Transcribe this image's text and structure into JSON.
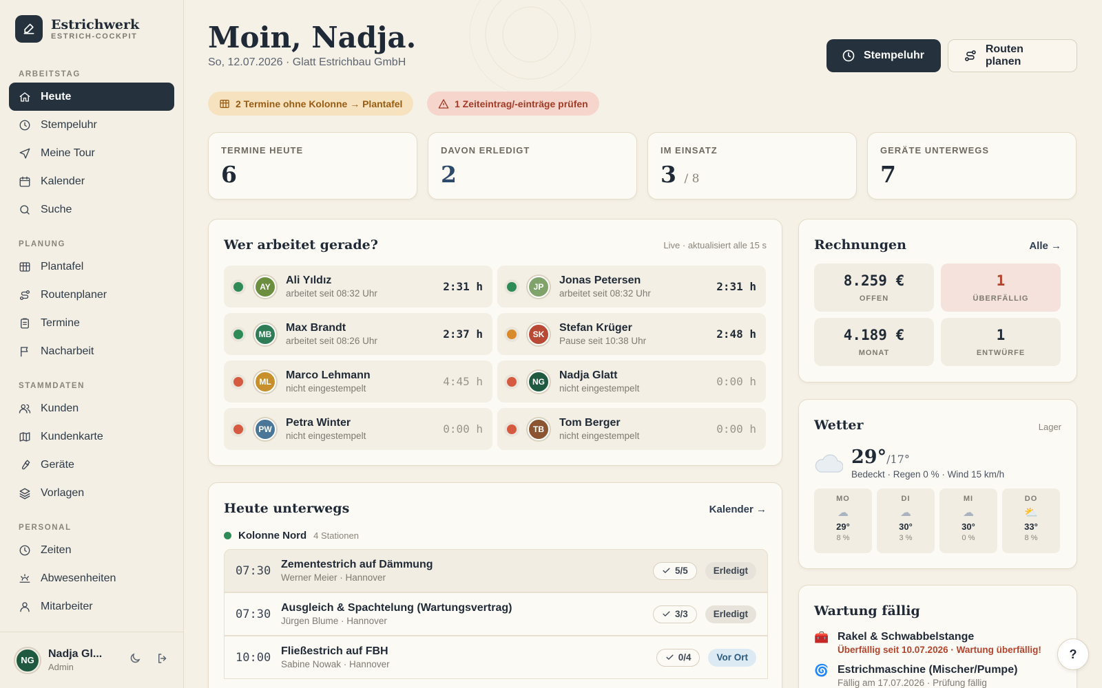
{
  "colors": {
    "accent_dark": "#25313d",
    "green": "#2e8b57",
    "orange": "#d98a2b",
    "red": "#d65a3f"
  },
  "brand": {
    "title": "Estrichwerk",
    "subtitle": "ESTRICH-COCKPIT",
    "icon": "pen-icon"
  },
  "sidebar": {
    "sections": [
      {
        "label": "ARBEITSTAG",
        "items": [
          {
            "label": "Heute",
            "icon": "home-icon",
            "active": true
          },
          {
            "label": "Stempeluhr",
            "icon": "clock-icon"
          },
          {
            "label": "Meine Tour",
            "icon": "navigation-icon"
          },
          {
            "label": "Kalender",
            "icon": "calendar-icon"
          },
          {
            "label": "Suche",
            "icon": "search-icon"
          }
        ]
      },
      {
        "label": "PLANUNG",
        "items": [
          {
            "label": "Plantafel",
            "icon": "grid-icon"
          },
          {
            "label": "Routenplaner",
            "icon": "route-icon"
          },
          {
            "label": "Termine",
            "icon": "clipboard-icon"
          },
          {
            "label": "Nacharbeit",
            "icon": "flag-icon"
          }
        ]
      },
      {
        "label": "STAMMDATEN",
        "items": [
          {
            "label": "Kunden",
            "icon": "users-icon"
          },
          {
            "label": "Kundenkarte",
            "icon": "map-icon"
          },
          {
            "label": "Geräte",
            "icon": "wrench-icon"
          },
          {
            "label": "Vorlagen",
            "icon": "layers-icon"
          }
        ]
      },
      {
        "label": "PERSONAL",
        "items": [
          {
            "label": "Zeiten",
            "icon": "clock-icon"
          },
          {
            "label": "Abwesenheiten",
            "icon": "sun-icon"
          },
          {
            "label": "Mitarbeiter",
            "icon": "user-icon"
          }
        ]
      }
    ]
  },
  "user": {
    "initials": "NG",
    "name": "Nadja Gl...",
    "role": "Admin"
  },
  "header": {
    "greeting": "Moin, Nadja.",
    "subline": "So, 12.07.2026 · Glatt Estrichbau GmbH",
    "btn_clock": "Stempeluhr",
    "btn_routes": "Routen planen"
  },
  "alerts": {
    "unassigned": "2 Termine ohne Kolonne → Plantafel",
    "time_check": "1 Zeiteintrag/-einträge prüfen"
  },
  "kpis": [
    {
      "label": "TERMINE HEUTE",
      "value": "6"
    },
    {
      "label": "DAVON ERLEDIGT",
      "value": "2"
    },
    {
      "label": "IM EINSATZ",
      "value": "3",
      "suffix": "/ 8"
    },
    {
      "label": "GERÄTE UNTERWEGS",
      "value": "7"
    }
  ],
  "workers": {
    "title": "Wer arbeitet gerade?",
    "hint": "Live · aktualisiert alle 15 s",
    "list": [
      {
        "initials": "AY",
        "name": "Ali Yıldız",
        "status": "arbeitet seit 08:32 Uhr",
        "time": "2:31 h",
        "state": "green",
        "avatar": "#6b8f3f"
      },
      {
        "initials": "JP",
        "name": "Jonas Petersen",
        "status": "arbeitet seit 08:32 Uhr",
        "time": "2:31 h",
        "state": "green",
        "avatar": "#7fa36a"
      },
      {
        "initials": "MB",
        "name": "Max Brandt",
        "status": "arbeitet seit 08:26 Uhr",
        "time": "2:37 h",
        "state": "green",
        "avatar": "#2f7d57"
      },
      {
        "initials": "SK",
        "name": "Stefan Krüger",
        "status": "Pause seit 10:38 Uhr",
        "time": "2:48 h",
        "state": "orange",
        "avatar": "#b84a35"
      },
      {
        "initials": "ML",
        "name": "Marco Lehmann",
        "status": "nicht eingestempelt",
        "time": "4:45 h",
        "state": "red",
        "avatar": "#c8902d"
      },
      {
        "initials": "NG",
        "name": "Nadja Glatt",
        "status": "nicht eingestempelt",
        "time": "0:00 h",
        "state": "red",
        "avatar": "#1f5a40"
      },
      {
        "initials": "PW",
        "name": "Petra Winter",
        "status": "nicht eingestempelt",
        "time": "0:00 h",
        "state": "red",
        "avatar": "#4a7697"
      },
      {
        "initials": "TB",
        "name": "Tom Berger",
        "status": "nicht eingestempelt",
        "time": "0:00 h",
        "state": "red",
        "avatar": "#8a5530"
      }
    ]
  },
  "invoices": {
    "title": "Rechnungen",
    "link": "Alle →",
    "tiles": [
      {
        "value": "8.259 €",
        "label": "OFFEN"
      },
      {
        "value": "1",
        "label": "ÜBERFÄLLIG",
        "alert": true
      },
      {
        "value": "4.189 €",
        "label": "MONAT"
      },
      {
        "value": "1",
        "label": "ENTWÜRFE"
      }
    ]
  },
  "weather": {
    "title": "Wetter",
    "location": "Lager",
    "temp": "29°",
    "low": "/17°",
    "desc": "Bedeckt · Regen 0 % · Wind 15 km/h",
    "icon": "cloud-icon",
    "days": [
      {
        "name": "MO",
        "icon": "cloud-icon",
        "glyph": "☁",
        "temp": "29°",
        "rain": "8 %"
      },
      {
        "name": "DI",
        "icon": "cloud-icon",
        "glyph": "☁",
        "temp": "30°",
        "rain": "3 %"
      },
      {
        "name": "MI",
        "icon": "cloud-icon",
        "glyph": "☁",
        "temp": "30°",
        "rain": "0 %"
      },
      {
        "name": "DO",
        "icon": "partly-sunny-icon",
        "glyph": "⛅",
        "temp": "33°",
        "rain": "8 %"
      }
    ]
  },
  "maintenance": {
    "title": "Wartung fällig",
    "items": [
      {
        "icon": "toolbox-icon",
        "glyph": "🧰",
        "name": "Rakel & Schwabbelstange",
        "sub": "Überfällig seit 10.07.2026 · Wartung überfällig!",
        "overdue": true
      },
      {
        "icon": "mixer-icon",
        "glyph": "🌀",
        "name": "Estrichmaschine (Mischer/Pumpe)",
        "sub": "Fällig am 17.07.2026 · Prüfung fällig",
        "overdue": false
      }
    ]
  },
  "tour": {
    "title": "Heute unterwegs",
    "link": "Kalender →",
    "crew": "Kolonne Nord",
    "crew_count": "4 Stationen",
    "rows": [
      {
        "time": "07:30",
        "title": "Zementestrich auf Dämmung",
        "sub": "Werner Meier · Hannover",
        "check": "5/5",
        "status": "Erledigt",
        "kind": "done"
      },
      {
        "time": "07:30",
        "title": "Ausgleich & Spachtelung (Wartungsvertrag)",
        "sub": "Jürgen Blume · Hannover",
        "check": "3/3",
        "status": "Erledigt",
        "kind": "done"
      },
      {
        "time": "10:00",
        "title": "Fließestrich auf FBH",
        "sub": "Sabine Nowak · Hannover",
        "check": "0/4",
        "status": "Vor Ort",
        "kind": "onsite"
      }
    ]
  },
  "help": {
    "label": "?"
  }
}
